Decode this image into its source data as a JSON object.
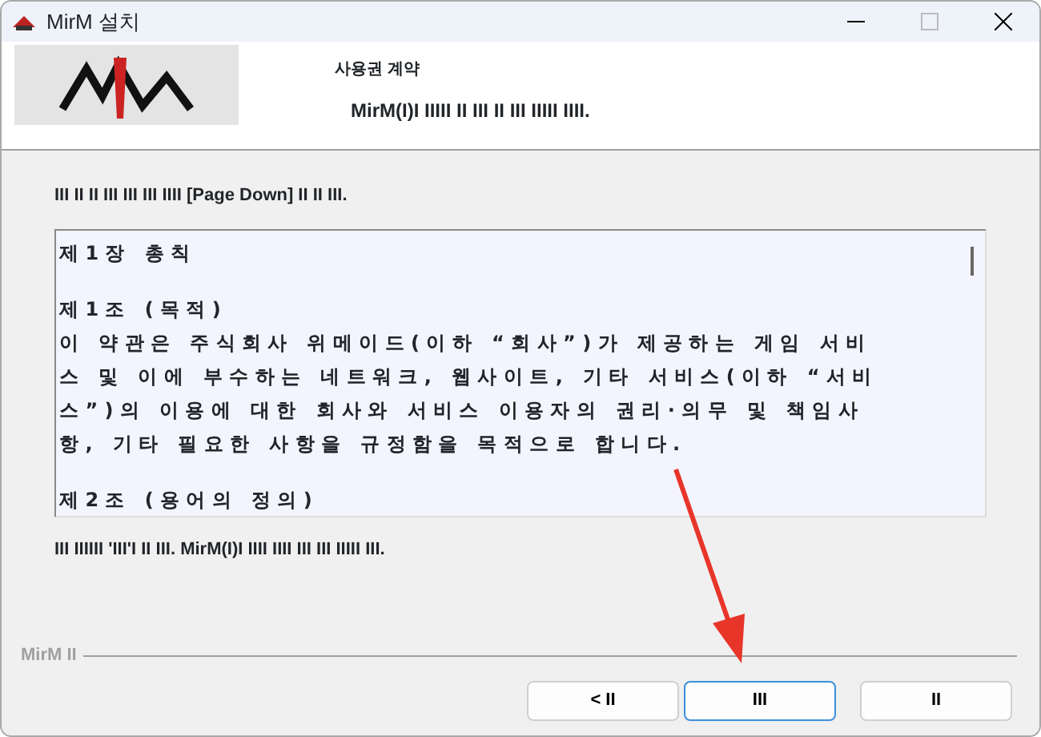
{
  "window": {
    "title": "MirM 설치"
  },
  "header": {
    "title": "사용권 계약",
    "subtitle": "MirM(I)I IIIII II III II III IIIII IIII."
  },
  "instruction": "III II II III III III IIII [Page Down] II II III.",
  "license": {
    "paragraphs": [
      {
        "lines": [
          "제1장 총칙"
        ]
      },
      {
        "lines": [
          "제1조 (목적)",
          "이 약관은 주식회사 위메이드(이하 “회사”)가 제공하는 게임 서비",
          "스 및 이에 부수하는 네트워크, 웹사이트, 기타 서비스(이하 “서비",
          "스”)의 이용에 대한 회사와 서비스 이용자의 권리·의무 및 책임사",
          "항, 기타 필요한 사항을 규정함을 목적으로 합니다."
        ]
      },
      {
        "lines": [
          "제2조 (용어의 정의)"
        ]
      }
    ]
  },
  "footer_note": "III IIIIII 'III'I II III. MirM(I)I IIII IIII III III IIIII III.",
  "brand": "MirM II",
  "buttons": [
    {
      "label": "< II",
      "focused": false
    },
    {
      "label": "III",
      "focused": true
    },
    {
      "label": "II",
      "focused": false
    }
  ]
}
